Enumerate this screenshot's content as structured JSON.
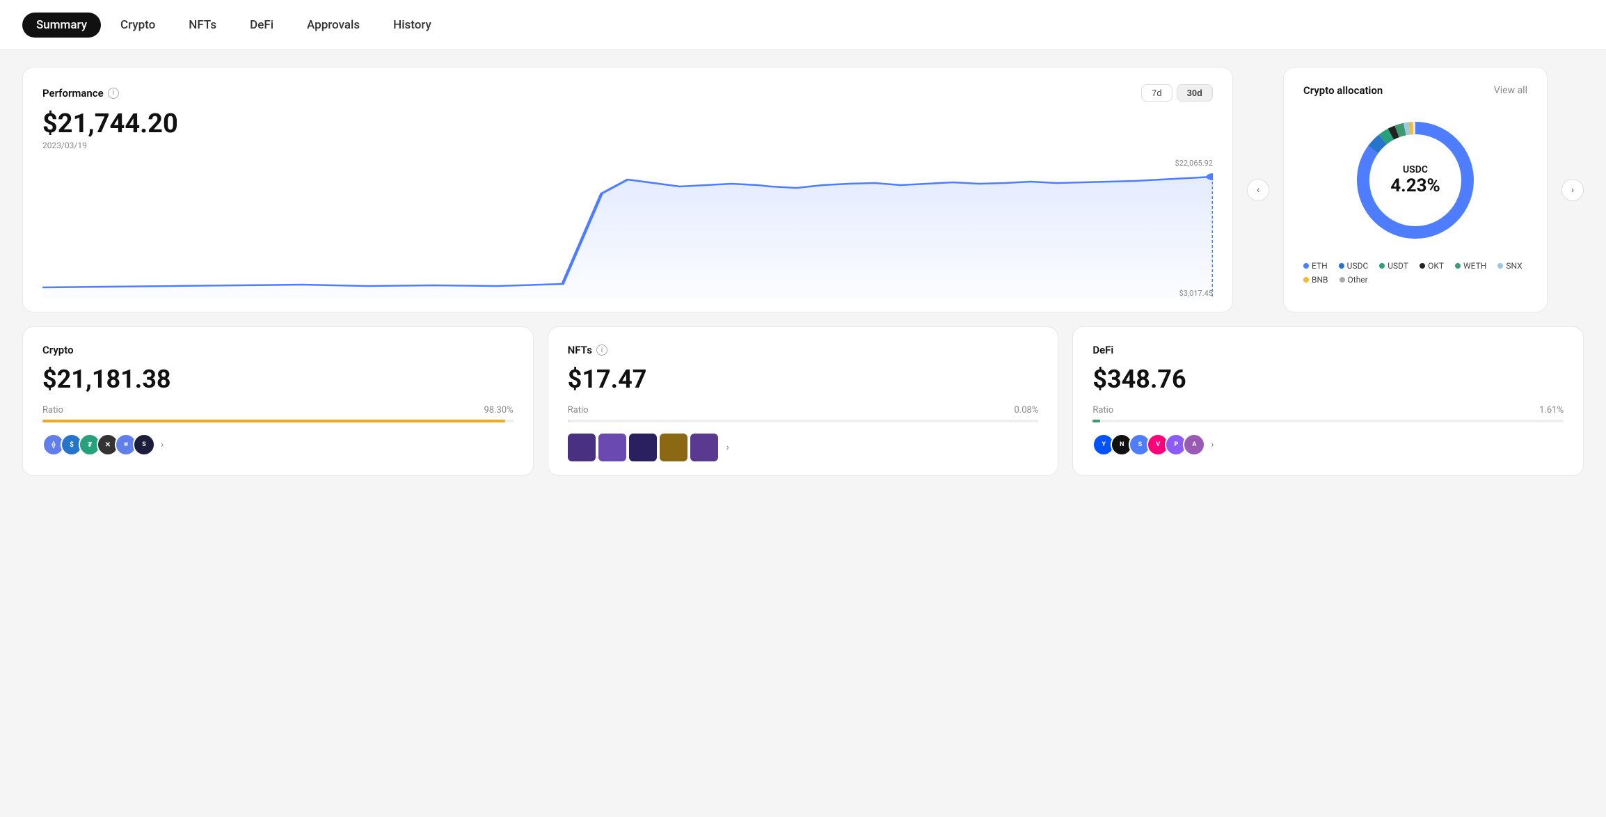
{
  "nav": {
    "items": [
      {
        "id": "summary",
        "label": "Summary",
        "active": true
      },
      {
        "id": "crypto",
        "label": "Crypto",
        "active": false
      },
      {
        "id": "nfts",
        "label": "NFTs",
        "active": false
      },
      {
        "id": "defi",
        "label": "DeFi",
        "active": false
      },
      {
        "id": "approvals",
        "label": "Approvals",
        "active": false
      },
      {
        "id": "history",
        "label": "History",
        "active": false
      }
    ]
  },
  "performance": {
    "title": "Performance",
    "value": "$21,744.20",
    "date": "2023/03/19",
    "time_buttons": [
      {
        "label": "7d",
        "active": false
      },
      {
        "label": "30d",
        "active": true
      }
    ],
    "chart_max": "$22,065.92",
    "chart_min": "$3,017.45"
  },
  "allocation": {
    "title": "Crypto allocation",
    "view_all": "View all",
    "center_label": "USDC",
    "center_pct": "4.23%",
    "legend": [
      {
        "label": "ETH",
        "color": "#4E7EFF"
      },
      {
        "label": "USDC",
        "color": "#2775CA"
      },
      {
        "label": "USDT",
        "color": "#26A17B"
      },
      {
        "label": "OKT",
        "color": "#111"
      },
      {
        "label": "WETH",
        "color": "#3D9970"
      },
      {
        "label": "SNX",
        "color": "#a0c8e0"
      },
      {
        "label": "BNB",
        "color": "#F3BA2F"
      },
      {
        "label": "Other",
        "color": "#aaa"
      }
    ],
    "donut_segments": [
      {
        "label": "ETH",
        "pct": 85,
        "color": "#4E7EFF"
      },
      {
        "label": "USDC",
        "pct": 4.23,
        "color": "#2775CA"
      },
      {
        "label": "USDT",
        "pct": 3,
        "color": "#26A17B"
      },
      {
        "label": "OKT",
        "pct": 2,
        "color": "#222"
      },
      {
        "label": "WETH",
        "pct": 2.5,
        "color": "#3D9970"
      },
      {
        "label": "SNX",
        "pct": 1.5,
        "color": "#a0c8e0"
      },
      {
        "label": "BNB",
        "pct": 1,
        "color": "#F3BA2F"
      },
      {
        "label": "Other",
        "pct": 0.77,
        "color": "#ccc"
      }
    ]
  },
  "crypto_card": {
    "title": "Crypto",
    "value": "$21,181.38",
    "ratio_label": "Ratio",
    "ratio_pct": "98.30%",
    "bar_color": "#F5A623",
    "bar_fill_pct": 98.3,
    "tokens": [
      {
        "symbol": "ETH",
        "color": "#627EEA"
      },
      {
        "symbol": "$",
        "color": "#2775CA"
      },
      {
        "symbol": "T",
        "color": "#26A17B"
      },
      {
        "symbol": "✕",
        "color": "#333"
      },
      {
        "symbol": "W",
        "color": "#627EEA"
      },
      {
        "symbol": "S",
        "color": "#1c1c3c"
      }
    ]
  },
  "nfts_card": {
    "title": "NFTs",
    "value": "$17.47",
    "ratio_label": "Ratio",
    "ratio_pct": "0.08%",
    "bar_color": "#ddd",
    "bar_fill_pct": 0.08,
    "thumbs": [
      {
        "color": "#4a3080"
      },
      {
        "color": "#6a4ab0"
      },
      {
        "color": "#2a2060"
      },
      {
        "color": "#8b6914"
      },
      {
        "color": "#5a3a90"
      }
    ]
  },
  "defi_card": {
    "title": "DeFi",
    "value": "$348.76",
    "ratio_label": "Ratio",
    "ratio_pct": "1.61%",
    "bar_color": "#3D9970",
    "bar_fill_pct": 1.61,
    "tokens": [
      {
        "symbol": "Y",
        "color": "#0052FF"
      },
      {
        "symbol": "N",
        "color": "#111"
      },
      {
        "symbol": "S",
        "color": "#4E7EFF"
      },
      {
        "symbol": "V",
        "color": "#FF007A"
      },
      {
        "symbol": "P",
        "color": "#8b5cf6"
      },
      {
        "symbol": "A",
        "color": "#9b59b6"
      }
    ]
  }
}
